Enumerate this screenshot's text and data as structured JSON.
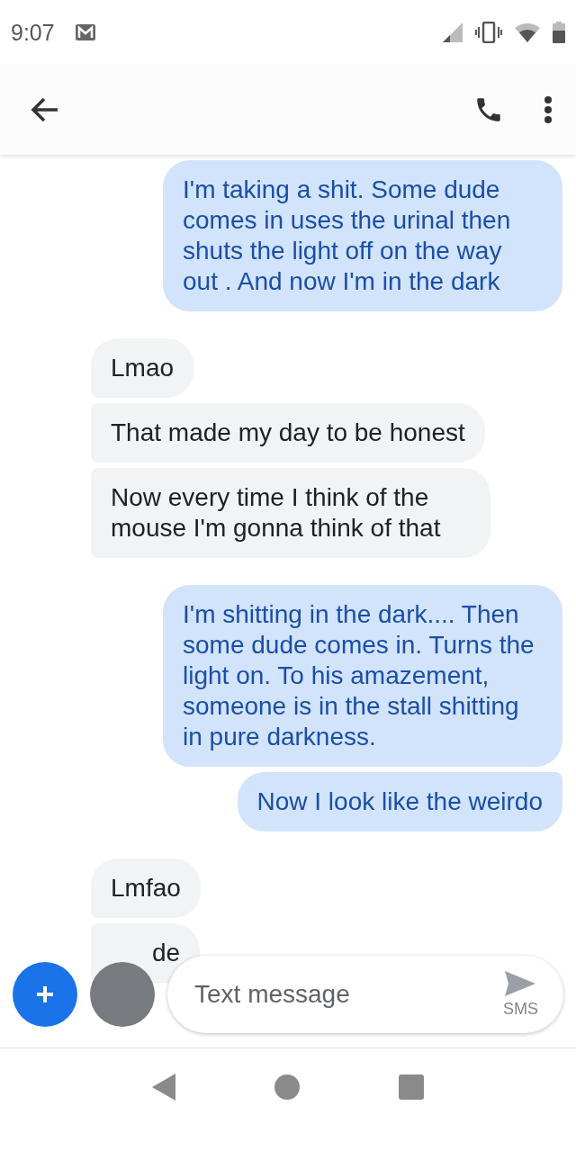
{
  "status_bar": {
    "time": "9:07"
  },
  "messages": [
    {
      "kind": "outgoing",
      "text": "I'm taking a shit. Some dude comes in uses the urinal then shuts the light off on the way out . And now I'm in the dark",
      "first": true
    },
    {
      "kind": "incoming",
      "text": "Lmao",
      "first": true
    },
    {
      "kind": "incoming",
      "text": "That made my day to be honest",
      "first": false
    },
    {
      "kind": "incoming",
      "text": "Now every time I think of the mouse I'm gonna think of that",
      "first": false
    },
    {
      "kind": "outgoing",
      "text": "I'm shitting in the dark.... Then some dude comes in. Turns the light on. To his amazement, someone is in the stall shitting in pure darkness.",
      "first": true
    },
    {
      "kind": "outgoing",
      "text": "Now I look like the weirdo",
      "first": false
    },
    {
      "kind": "incoming",
      "text": "Lmfao",
      "first": true
    },
    {
      "kind": "incoming",
      "text": "de",
      "first": false
    }
  ],
  "compose": {
    "placeholder": "Text message",
    "send_label": "SMS"
  }
}
